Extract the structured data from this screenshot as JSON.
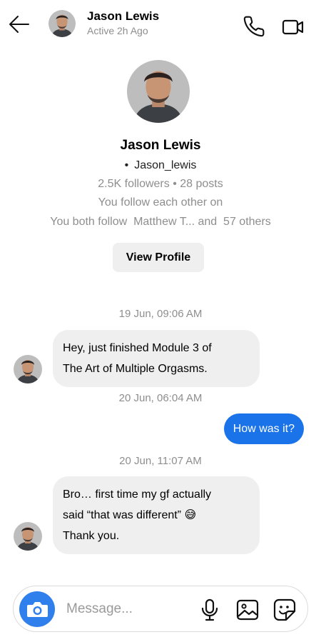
{
  "header": {
    "name": "Jason Lewis",
    "status": "Active 2h Ago",
    "icons": {
      "back": "back-arrow-icon",
      "call": "phone-icon",
      "video": "video-camera-icon"
    }
  },
  "profile": {
    "name": "Jason Lewis",
    "bullet": "•",
    "handle": "Jason_lewis",
    "stats": "2.5K followers • 28 posts",
    "follow_status": "You follow each other on",
    "mutual": "You both follow  Matthew T... and  57 others",
    "view_profile_label": "View Profile"
  },
  "messages": [
    {
      "timestamp": "19 Jun, 09:06 AM",
      "direction": "incoming",
      "lines": [
        "Hey, just finished Module 3 of",
        "The Art of Multiple Orgasms."
      ]
    },
    {
      "timestamp": "20 Jun, 06:04 AM",
      "direction": "outgoing",
      "lines": [
        "How was it?"
      ]
    },
    {
      "timestamp": "20 Jun, 11:07 AM",
      "direction": "incoming",
      "lines": [
        "Bro… first time my gf actually",
        "said “that was different” 😅",
        "Thank you."
      ]
    }
  ],
  "composer": {
    "placeholder": "Message...",
    "icons": {
      "camera": "camera-icon",
      "mic": "microphone-icon",
      "gallery": "gallery-icon",
      "sticker": "sticker-icon"
    }
  },
  "colors": {
    "accent": "#1a73e8",
    "camera": "#2f80ed",
    "bubble_in": "#efefef",
    "muted_text": "#8e8e8e"
  }
}
